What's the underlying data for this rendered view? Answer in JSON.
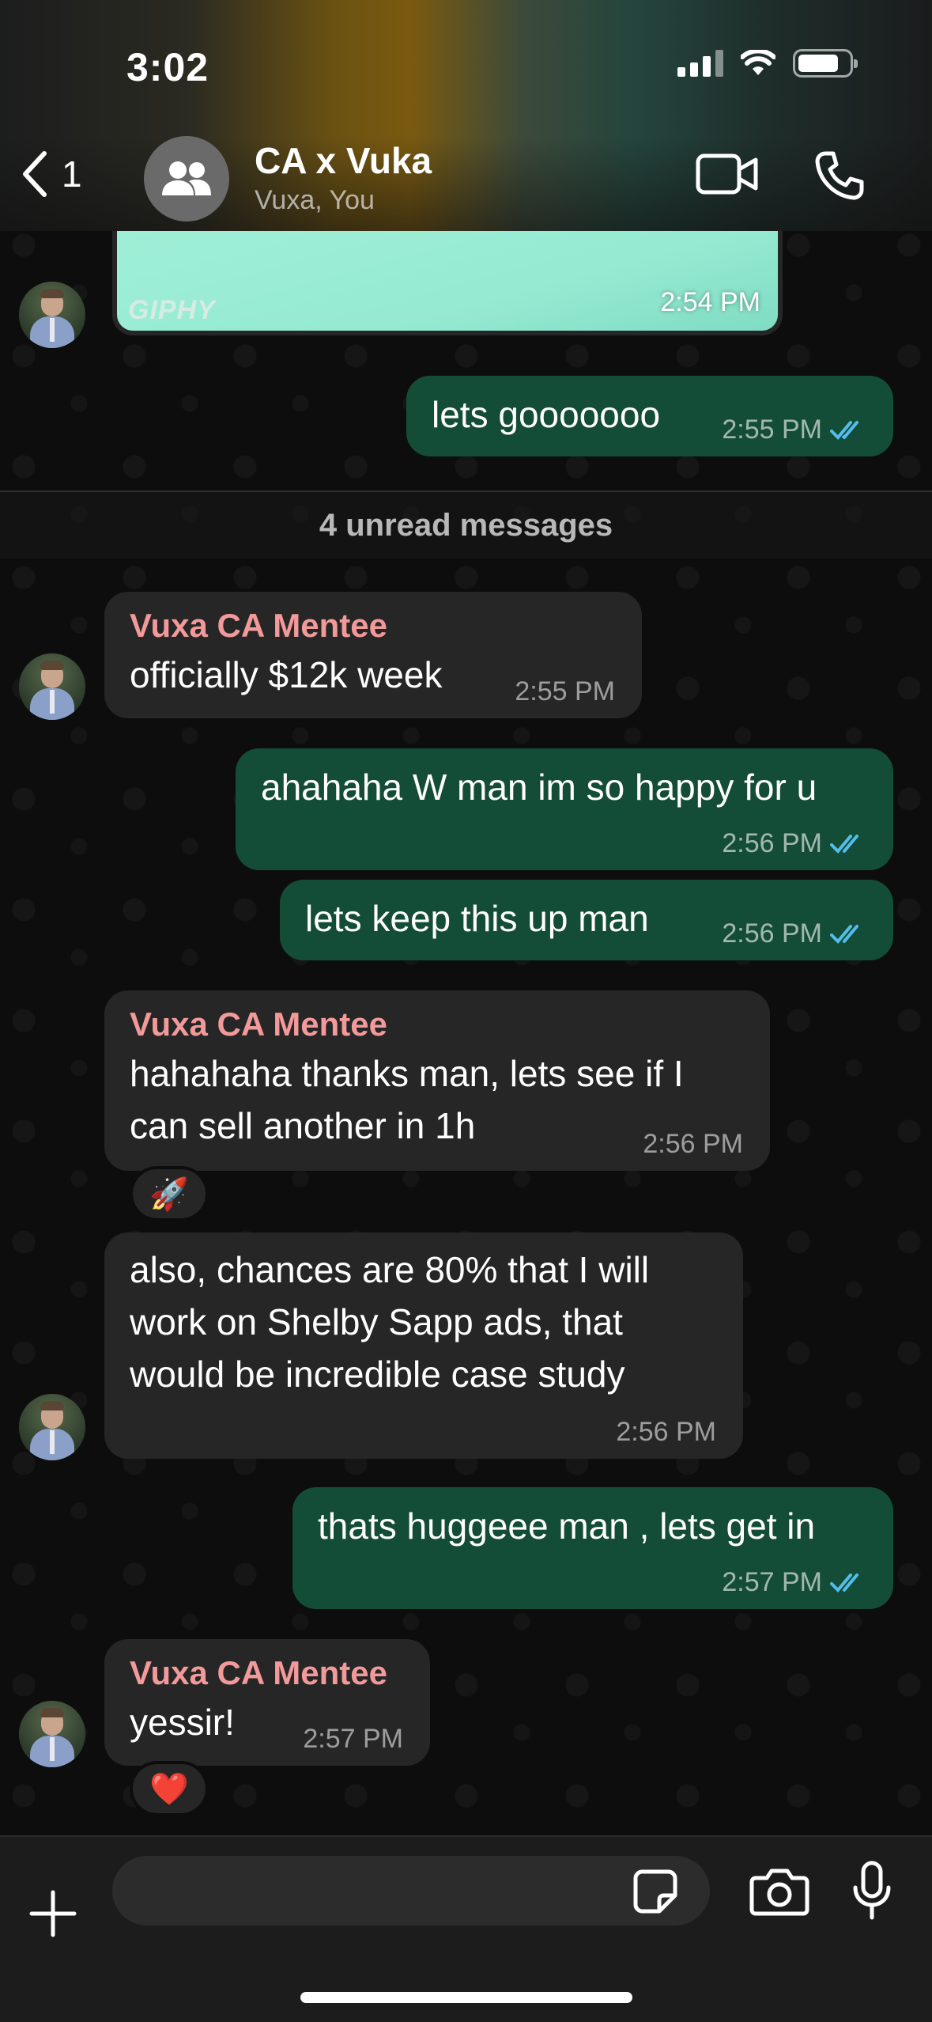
{
  "status_bar": {
    "time": "3:02"
  },
  "header": {
    "back_count": "1",
    "title": "CA x Vuka",
    "subtitle": "Vuxa, You",
    "icons": [
      "back-chevron-icon",
      "group-icon",
      "video-icon",
      "phone-icon"
    ]
  },
  "gif": {
    "label": "GIPHY",
    "time": "2:54 PM"
  },
  "unread_divider": "4 unread messages",
  "messages": [
    {
      "dir": "out",
      "text": "lets gooooooo",
      "time": "2:55 PM",
      "read": true
    },
    {
      "dir": "in",
      "sender": "Vuxa CA Mentee",
      "text": "officially $12k week",
      "time": "2:55 PM"
    },
    {
      "dir": "out",
      "text": "ahahaha W man im so happy for u",
      "time": "2:56 PM",
      "read": true
    },
    {
      "dir": "out",
      "text": "lets keep this up man",
      "time": "2:56 PM",
      "read": true
    },
    {
      "dir": "in",
      "sender": "Vuxa CA Mentee",
      "text_lines": [
        "hahahaha thanks man, lets see if I",
        "can sell another in 1h"
      ],
      "time": "2:56 PM",
      "reaction": "🚀"
    },
    {
      "dir": "in",
      "text_lines": [
        "also, chances are 80% that I will",
        "work on Shelby Sapp ads, that",
        "would be incredible case study"
      ],
      "time": "2:56 PM"
    },
    {
      "dir": "out",
      "text": "thats huggeee man , lets get in",
      "time": "2:57 PM",
      "read": true
    },
    {
      "dir": "in",
      "sender": "Vuxa CA Mentee",
      "text": "yessir!",
      "time": "2:57 PM",
      "reaction": "❤️"
    }
  ],
  "composer": {
    "placeholder": ""
  },
  "colors": {
    "incoming": "#262626",
    "outgoing": "#144d37",
    "sender": "#f29a9a",
    "read_ticks": "#53bdeb"
  }
}
